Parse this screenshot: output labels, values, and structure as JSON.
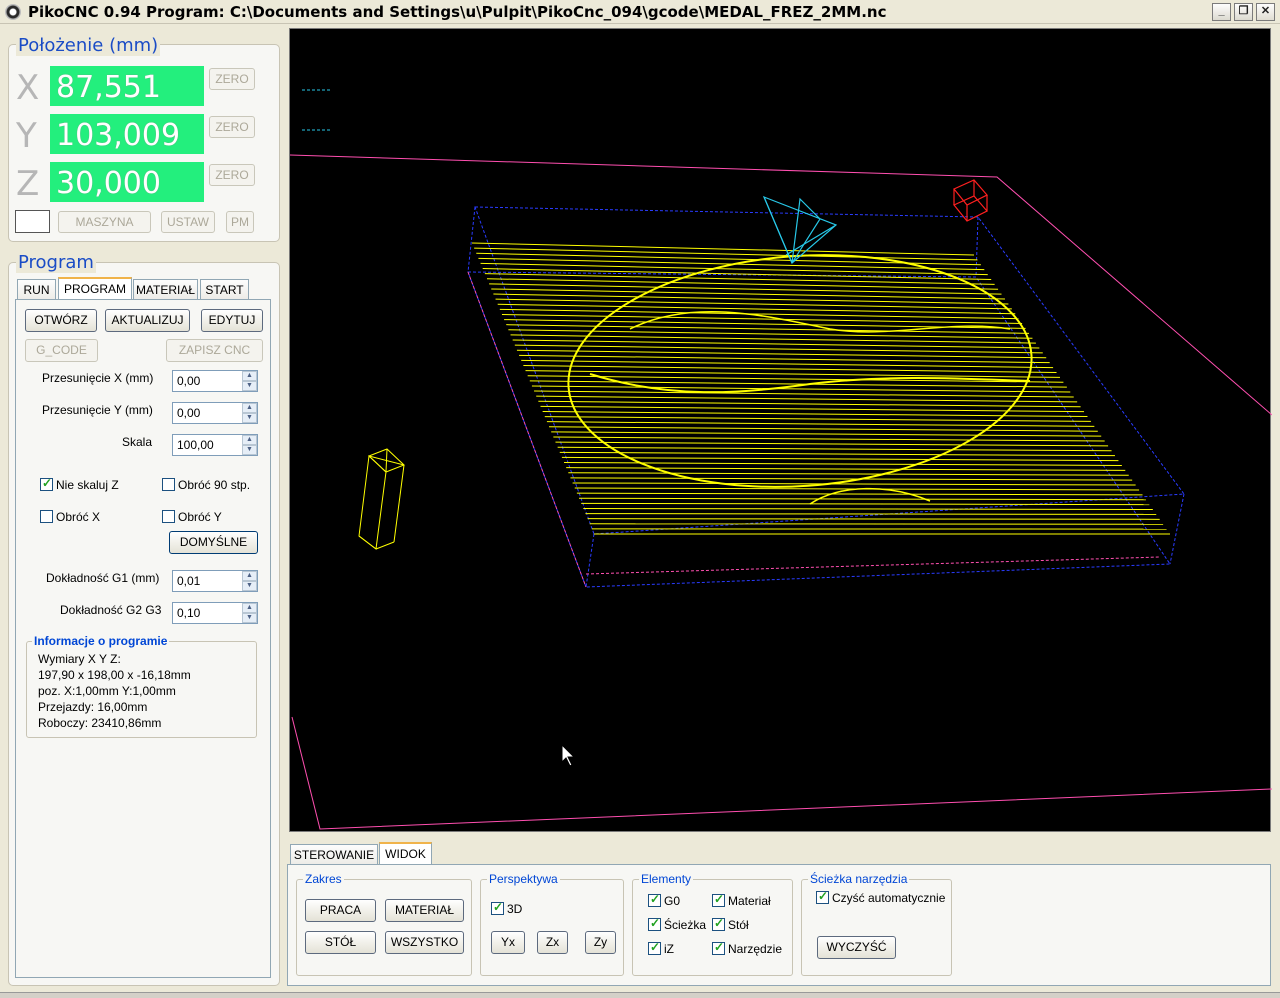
{
  "window": {
    "title": "PikoCNC 0.94     Program:  C:\\Documents and Settings\\u\\Pulpit\\PikoCnc_094\\gcode\\MEDAL_FREZ_2MM.nc",
    "min_label": "_",
    "max_label": "❐",
    "close_label": "✕"
  },
  "position": {
    "title": "Położenie (mm)",
    "x_letter": "X",
    "x_value": "87,551",
    "y_letter": "Y",
    "y_value": "103,009",
    "z_letter": "Z",
    "z_value": "30,000",
    "zero_label": "ZERO",
    "maszyna_label": "MASZYNA",
    "ustaw_label": "USTAW",
    "pm_label": "PM"
  },
  "program": {
    "title": "Program",
    "tabs": [
      "RUN",
      "PROGRAM",
      "MATERIAŁ",
      "START"
    ],
    "active_tab": "PROGRAM",
    "otworz": "OTWÓRZ",
    "aktualizuj": "AKTUALIZUJ",
    "edytuj": "EDYTUJ",
    "gcode": "G_CODE",
    "zapisz": "ZAPISZ CNC",
    "offset_x_label": "Przesunięcie X (mm)",
    "offset_x_value": "0,00",
    "offset_y_label": "Przesunięcie Y (mm)",
    "offset_y_value": "0,00",
    "scale_label": "Skala",
    "scale_value": "100,00",
    "nie_skaluj_z": "Nie skaluj Z",
    "obroc_90": "Obróć 90 stp.",
    "obroc_x": "Obróć X",
    "obroc_y": "Obróć Y",
    "domyslne": "DOMYŚLNE",
    "g1_label": "Dokładność G1 (mm)",
    "g1_value": "0,01",
    "g23_label": "Dokładność G2 G3",
    "g23_value": "0,10",
    "info_title": "Informacje o programie",
    "info_lines": [
      "Wymiary X Y Z:",
      "197,90 x 198,00 x -16,18mm",
      "poz. X:1,00mm Y:1,00mm",
      "Przejazdy: 16,00mm",
      "Roboczy: 23410,86mm"
    ]
  },
  "bottom": {
    "tabs": [
      "STEROWANIE",
      "WIDOK"
    ],
    "active_tab": "WIDOK",
    "zakres_title": "Zakres",
    "praca": "PRACA",
    "material": "MATERIAŁ",
    "stol": "STÓŁ",
    "wszystko": "WSZYSTKO",
    "perspektywa_title": "Perspektywa",
    "p3d": "3D",
    "yx": "Yx",
    "zx": "Zx",
    "zy": "Zy",
    "elementy_title": "Elementy",
    "g0": "G0",
    "material_el": "Materiał",
    "sciezka": "Ścieżka",
    "stol_el": "Stół",
    "iz": "iZ",
    "narzedzie": "Narzędzie",
    "sciezka_title": "Ścieżka narzędzia",
    "czysc_auto": "Czyść automatycznie",
    "wyczysc": "WYCZYŚĆ"
  },
  "colors": {
    "accent_title": "#1a4cc6",
    "position_bg": "#23ef7d",
    "toolpath": "#ffff00",
    "material_box": "#2a3cff",
    "table_outline": "#ff4fb0",
    "tool": "#28c8e8",
    "origin": "#ff2020"
  }
}
